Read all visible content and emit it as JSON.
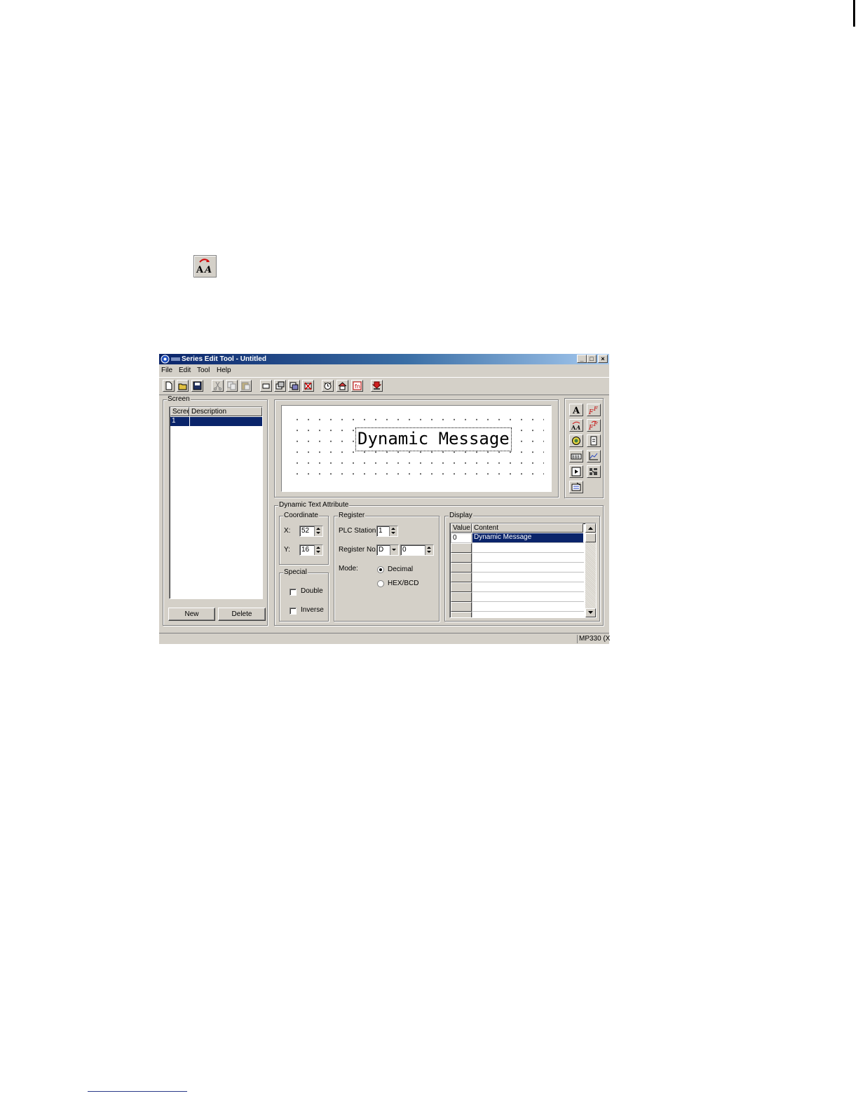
{
  "window": {
    "title": "Series Edit Tool - Untitled",
    "minimize_glyph": "_",
    "maximize_glyph": "□",
    "close_glyph": "×"
  },
  "menu": [
    "File",
    "Edit",
    "Tool",
    "Help"
  ],
  "toolbar_icons": [
    "new-file-icon",
    "open-folder-icon",
    "save-icon",
    "cut-icon",
    "copy-icon",
    "paste-icon",
    "rectangle-icon",
    "new-screen-icon",
    "copy-screen-icon",
    "delete-screen-icon",
    "alarm-icon",
    "home-icon",
    "function-icon",
    "download-icon"
  ],
  "screen_panel": {
    "label": "Screen",
    "columns": [
      "Scree",
      "Description"
    ],
    "rows": [
      {
        "number": "1",
        "description": ""
      }
    ],
    "new_button": "New",
    "delete_button": "Delete"
  },
  "canvas": {
    "dynamic_text": "Dynamic Message"
  },
  "palette_icons": [
    "static-text-icon",
    "static-text-style-icon",
    "dynamic-text-icon",
    "dynamic-text-style-icon",
    "lamp-icon",
    "input-icon",
    "numeric-display-icon",
    "trend-graph-icon",
    "function-key-icon",
    "bitmap-icon",
    "list-icon"
  ],
  "attributes": {
    "label": "Dynamic Text Attribute",
    "coordinate": {
      "label": "Coordinate",
      "x_label": "X:",
      "x_value": "52",
      "y_label": "Y:",
      "y_value": "16"
    },
    "special": {
      "label": "Special",
      "double_label": "Double",
      "double_checked": false,
      "inverse_label": "Inverse",
      "inverse_checked": false
    },
    "register": {
      "label": "Register",
      "plc_station_label": "PLC Station",
      "plc_station_value": "1",
      "register_no_label": "Register No.",
      "register_type": "D",
      "register_value": "0",
      "mode_label": "Mode:",
      "mode_decimal": "Decimal",
      "mode_hex": "HEX/BCD",
      "selected_mode": "Decimal"
    },
    "display": {
      "label": "Display",
      "columns": [
        "Value",
        "Content"
      ],
      "rows": [
        {
          "value": "0",
          "content": "Dynamic Message"
        }
      ]
    }
  },
  "status_bar": {
    "model": "MP330 (X"
  }
}
